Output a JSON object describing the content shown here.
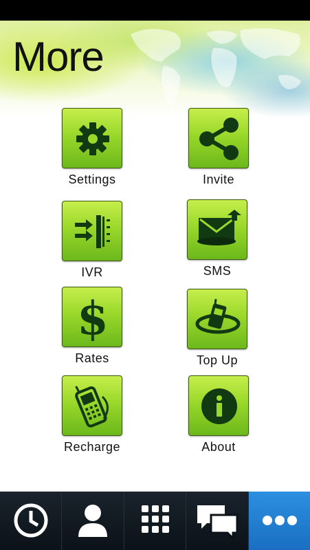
{
  "page": {
    "title": "More"
  },
  "tiles": [
    {
      "label": "Settings",
      "icon": "gear-icon"
    },
    {
      "label": "Invite",
      "icon": "share-icon"
    },
    {
      "label": "IVR",
      "icon": "ivr-icon"
    },
    {
      "label": "SMS",
      "icon": "sms-envelope-icon"
    },
    {
      "label": "Rates",
      "icon": "dollar-icon"
    },
    {
      "label": "Top Up",
      "icon": "topup-phone-icon"
    },
    {
      "label": "Recharge",
      "icon": "recharge-phone-icon"
    },
    {
      "label": "About",
      "icon": "info-icon"
    }
  ],
  "tabbar": {
    "items": [
      {
        "icon": "clock-icon"
      },
      {
        "icon": "contact-icon"
      },
      {
        "icon": "dialpad-icon"
      },
      {
        "icon": "chat-bubbles-icon"
      },
      {
        "icon": "more-dots-icon",
        "active": true
      }
    ],
    "active_color": "#2486d8"
  },
  "colors": {
    "tile_green_top": "#c6ee4c",
    "tile_green_bottom": "#6cb81c",
    "icon_dark": "#123a12"
  }
}
